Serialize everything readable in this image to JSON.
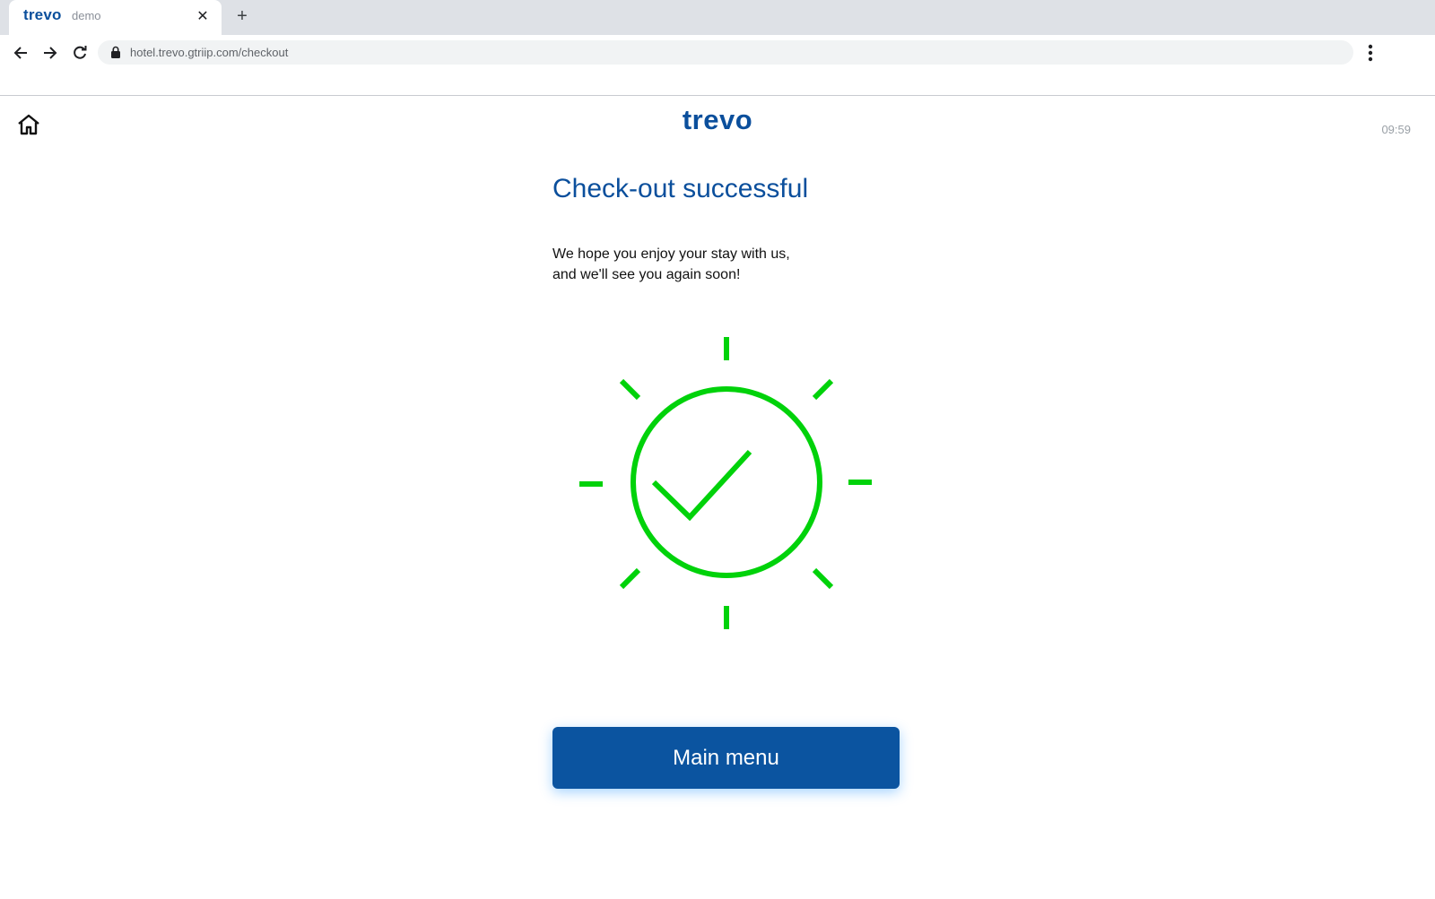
{
  "browser": {
    "tab": {
      "logo": "trevo",
      "subtitle": "demo",
      "close_icon": "close-icon"
    },
    "new_tab_label": "+",
    "url": "hotel.trevo.gtriip.com/checkout"
  },
  "page": {
    "brand": "trevo",
    "clock": "09:59",
    "title": "Check-out successful",
    "message_line1": "We hope you enjoy your stay with us,",
    "message_line2": "and we'll see you again soon!",
    "main_menu_label": "Main menu"
  },
  "colors": {
    "brand_blue": "#0b4f9c",
    "button_blue": "#0b54a0",
    "success_green": "#00d20a"
  },
  "icons": {
    "home": "home-icon",
    "back": "arrow-left-icon",
    "forward": "arrow-right-icon",
    "reload": "reload-icon",
    "lock": "lock-icon",
    "menu": "kebab-menu-icon",
    "success": "checkmark-circle-icon"
  }
}
